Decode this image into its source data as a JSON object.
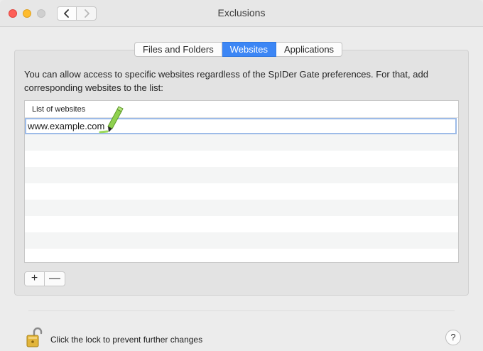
{
  "window": {
    "title": "Exclusions"
  },
  "tabs": [
    {
      "label": "Files and Folders",
      "active": false
    },
    {
      "label": "Websites",
      "active": true
    },
    {
      "label": "Applications",
      "active": false
    }
  ],
  "description": "You can allow access to specific websites regardless of the SpIDer Gate preferences. For that, add corresponding websites to the list:",
  "list": {
    "header": "List of websites",
    "editing_value": "www.example.com"
  },
  "controls": {
    "add_label": "+",
    "remove_label": "—"
  },
  "footer": {
    "lock_text": "Click the lock to prevent further changes",
    "help_label": "?"
  },
  "colors": {
    "accent": "#3c86f5",
    "close": "#fe5f57",
    "minimize": "#febc2e"
  }
}
